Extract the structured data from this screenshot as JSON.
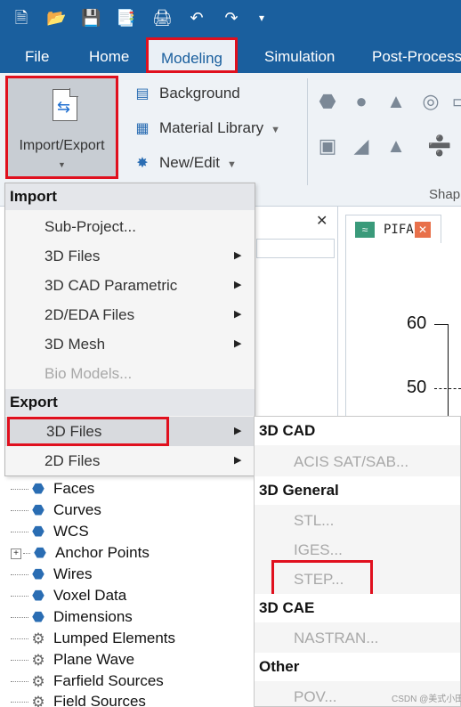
{
  "quick_access": {
    "icons": [
      "new-file-icon",
      "open-folder-icon",
      "save-icon",
      "save-all-icon",
      "print-icon",
      "undo-icon",
      "redo-icon",
      "customize-icon"
    ]
  },
  "ribbon_tabs": [
    {
      "label": "File"
    },
    {
      "label": "Home"
    },
    {
      "label": "Modeling"
    },
    {
      "label": "Simulation"
    },
    {
      "label": "Post-Process"
    }
  ],
  "ribbon": {
    "import_export_label": "Import/Export",
    "background_label": "Background",
    "material_library_label": "Material Library",
    "new_edit_label": "New/Edit",
    "shapes_group_label": "Shap"
  },
  "import_menu": {
    "import_header": "Import",
    "import_items": [
      {
        "label": "Sub-Project...",
        "disabled": false,
        "submenu": false
      },
      {
        "label": "3D Files",
        "disabled": false,
        "submenu": true
      },
      {
        "label": "3D CAD Parametric",
        "disabled": false,
        "submenu": true
      },
      {
        "label": "2D/EDA Files",
        "disabled": false,
        "submenu": true
      },
      {
        "label": "3D Mesh",
        "disabled": false,
        "submenu": true
      },
      {
        "label": "Bio Models...",
        "disabled": true,
        "submenu": false
      }
    ],
    "export_header": "Export",
    "export_items": [
      {
        "label": "3D Files",
        "disabled": false,
        "submenu": true
      },
      {
        "label": "2D Files",
        "disabled": false,
        "submenu": true
      }
    ]
  },
  "export_submenu": {
    "groups": [
      {
        "header": "3D CAD",
        "items": [
          "ACIS SAT/SAB..."
        ]
      },
      {
        "header": "3D General",
        "items": [
          "STL...",
          "IGES...",
          "STEP..."
        ]
      },
      {
        "header": "3D CAE",
        "items": [
          "NASTRAN..."
        ]
      },
      {
        "header": "Other",
        "items": [
          "POV..."
        ]
      }
    ]
  },
  "tree": {
    "items": [
      {
        "label": "Faces",
        "icon": "cube-icon",
        "expand": false
      },
      {
        "label": "Curves",
        "icon": "cube-icon",
        "expand": false
      },
      {
        "label": "WCS",
        "icon": "cube-icon",
        "expand": false
      },
      {
        "label": "Anchor Points",
        "icon": "cube-icon",
        "expand": true
      },
      {
        "label": "Wires",
        "icon": "cube-icon",
        "expand": false
      },
      {
        "label": "Voxel Data",
        "icon": "cube-icon",
        "expand": false
      },
      {
        "label": "Dimensions",
        "icon": "cube-icon",
        "expand": false
      },
      {
        "label": "Lumped Elements",
        "icon": "gear-icon",
        "expand": false
      },
      {
        "label": "Plane Wave",
        "icon": "gear-icon",
        "expand": false
      },
      {
        "label": "Farfield Sources",
        "icon": "gear-icon",
        "expand": false
      },
      {
        "label": "Field Sources",
        "icon": "gear-icon",
        "expand": false
      }
    ]
  },
  "document": {
    "tab_name": "PIFA",
    "axis_labels": [
      "60",
      "50"
    ]
  },
  "watermark": "CSDN @美式小田",
  "colors": {
    "ribbon_blue": "#1a5f9e",
    "highlight_red": "#e0101e"
  }
}
